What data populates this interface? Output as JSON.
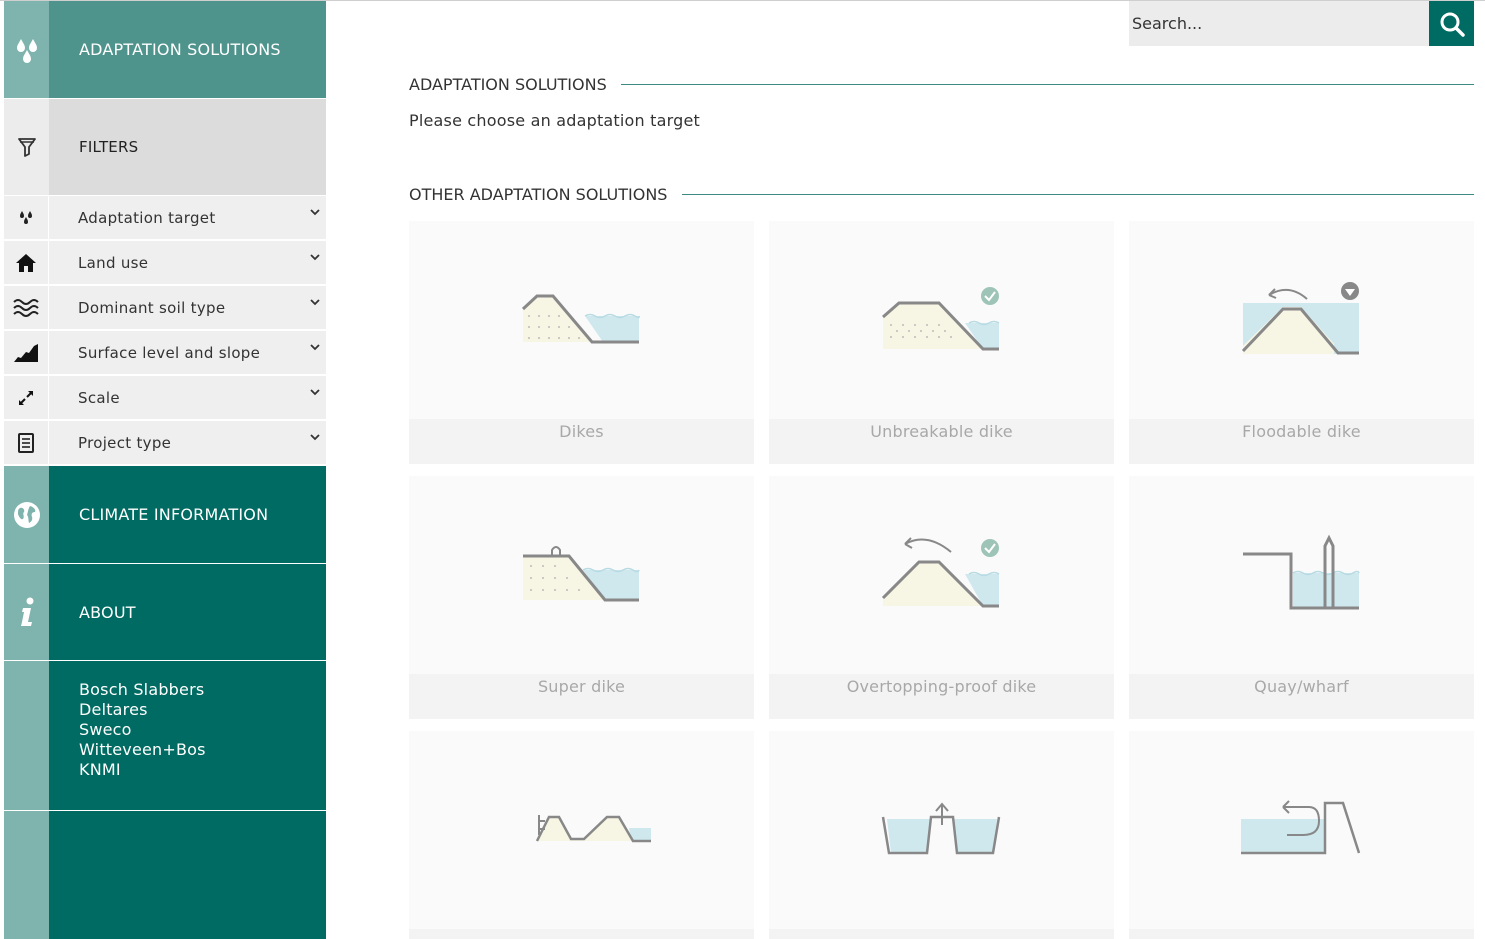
{
  "sidebar": {
    "adaptation_solutions": {
      "label": "ADAPTATION SOLUTIONS",
      "icon": "water-drops-icon"
    },
    "filters": {
      "label": "FILTERS",
      "icon": "filter-icon"
    },
    "filter_items": [
      {
        "label": "Adaptation target",
        "icon": "drops-icon"
      },
      {
        "label": "Land use",
        "icon": "house-icon"
      },
      {
        "label": "Dominant soil type",
        "icon": "waves-icon"
      },
      {
        "label": "Surface level and slope",
        "icon": "slope-icon"
      },
      {
        "label": "Scale",
        "icon": "expand-icon"
      },
      {
        "label": "Project type",
        "icon": "document-icon"
      }
    ],
    "climate_information": {
      "label": "CLIMATE INFORMATION",
      "icon": "globe-icon"
    },
    "about": {
      "label": "ABOUT",
      "icon": "info-icon"
    },
    "partners": [
      "Bosch Slabbers",
      "Deltares",
      "Sweco",
      "Witteveen+Bos",
      "KNMI"
    ]
  },
  "search": {
    "placeholder": "Search..."
  },
  "main": {
    "section_title": "ADAPTATION SOLUTIONS",
    "instruction": "Please choose an adaptation target",
    "other_title": "OTHER ADAPTATION SOLUTIONS",
    "cards": [
      {
        "title": "Dikes",
        "icon": "dike-icon"
      },
      {
        "title": "Unbreakable dike",
        "icon": "unbreakable-dike-icon"
      },
      {
        "title": "Floodable dike",
        "icon": "floodable-dike-icon"
      },
      {
        "title": "Super dike",
        "icon": "super-dike-icon"
      },
      {
        "title": "Overtopping-proof dike",
        "icon": "overtopping-proof-dike-icon"
      },
      {
        "title": "Quay/wharf",
        "icon": "quay-wharf-icon"
      },
      {
        "title": "",
        "icon": "multiple-dikes-icon"
      },
      {
        "title": "",
        "icon": "compartment-icon"
      },
      {
        "title": "",
        "icon": "return-flow-icon"
      }
    ]
  },
  "colors": {
    "teal_dark": "#006b62",
    "teal_mid": "#4f948c",
    "teal_light": "#7fb3ad",
    "water": "#cfe8ee",
    "sand": "#f7f5e3"
  }
}
